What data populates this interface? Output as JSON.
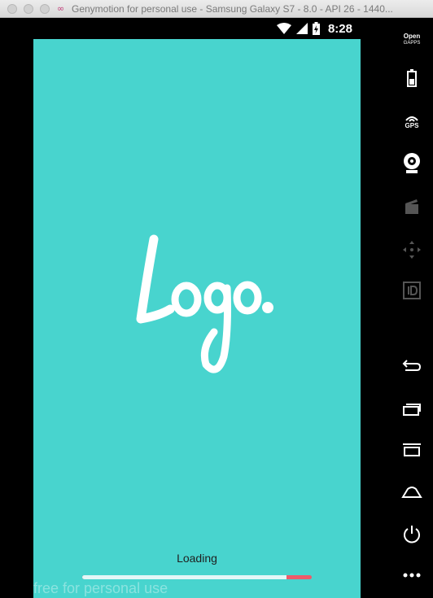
{
  "window": {
    "title": "Genymotion for personal use - Samsung Galaxy S7 - 8.0 - API 26 - 1440..."
  },
  "statusbar": {
    "time": "8:28",
    "icons": [
      "wifi-icon",
      "cell-signal-icon",
      "battery-charging-icon"
    ]
  },
  "screen": {
    "background": "#48d4ce",
    "logo_text": "Logo.",
    "loading_label": "Loading",
    "progress_fraction": 0.89,
    "progress_colors": {
      "fill": "#e4f7f7",
      "track": "#ee5a6a"
    },
    "watermark": "free for personal use"
  },
  "sidebar": {
    "gapps_label": "Open",
    "gapps_sublabel": "GAPPS",
    "gps_label": "GPS",
    "buttons": [
      "open-gapps-icon",
      "battery-icon",
      "gps-icon",
      "webcam-icon",
      "media-icon",
      "dpad-icon",
      "identifier-icon",
      "back-icon",
      "recent-apps-icon",
      "menu-icon",
      "home-icon",
      "power-icon",
      "more-icon"
    ]
  }
}
